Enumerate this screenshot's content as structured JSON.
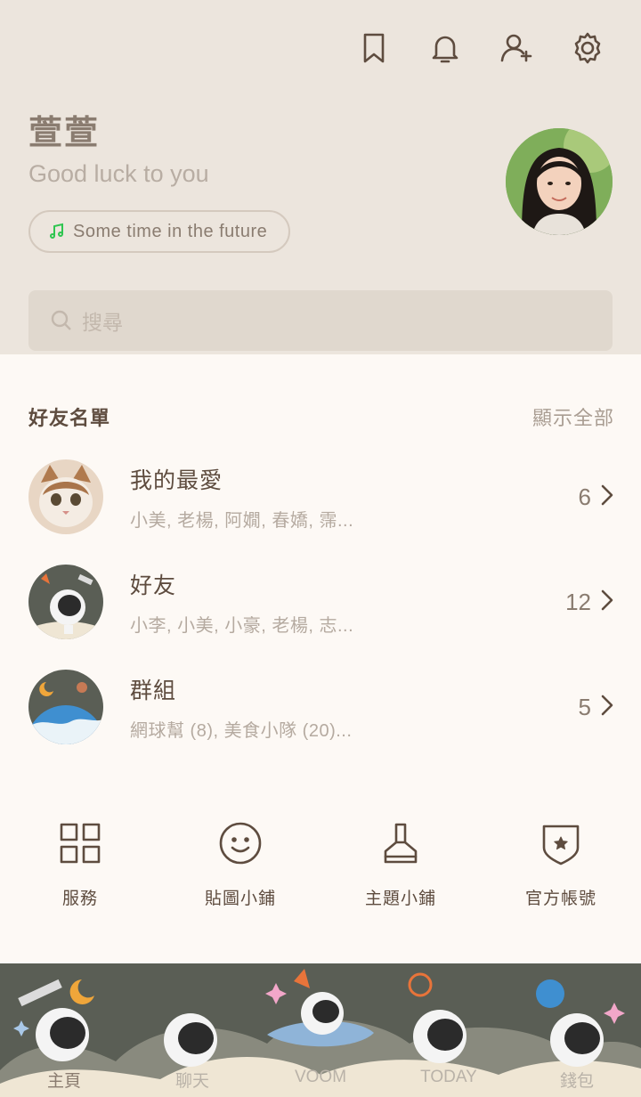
{
  "header": {
    "icons": [
      "bookmark-icon",
      "bell-icon",
      "add-friend-icon",
      "gear-icon"
    ],
    "profile_name": "萱萱",
    "status_message": "Good luck to you",
    "music": "Some time in the future",
    "search_placeholder": "搜尋"
  },
  "friends_section": {
    "title": "好友名單",
    "show_all": "顯示全部",
    "rows": [
      {
        "title": "我的最愛",
        "subtitle": "小美, 老楊, 阿嫺, 春嬌, 霈...",
        "count": "6"
      },
      {
        "title": "好友",
        "subtitle": "小李, 小美, 小豪, 老楊, 志...",
        "count": "12"
      },
      {
        "title": "群組",
        "subtitle": "網球幫 (8), 美食小隊 (20)...",
        "count": "5"
      }
    ]
  },
  "quick_actions": [
    {
      "label": "服務",
      "icon": "grid-icon"
    },
    {
      "label": "貼圖小鋪",
      "icon": "smiley-icon"
    },
    {
      "label": "主題小鋪",
      "icon": "brush-icon"
    },
    {
      "label": "官方帳號",
      "icon": "shield-star-icon"
    }
  ],
  "tabs": [
    {
      "label": "主頁",
      "active": true
    },
    {
      "label": "聊天",
      "active": false
    },
    {
      "label": "VOOM",
      "active": false
    },
    {
      "label": "TODAY",
      "active": false
    },
    {
      "label": "錢包",
      "active": false
    }
  ],
  "colors": {
    "header_bg": "#ece5dd",
    "page_bg": "#fdf9f5",
    "text_dark": "#5e4c3f",
    "text_muted": "#b5aaa0",
    "music_note": "#2fc550",
    "tabbar_bg": "#5a5e55"
  }
}
